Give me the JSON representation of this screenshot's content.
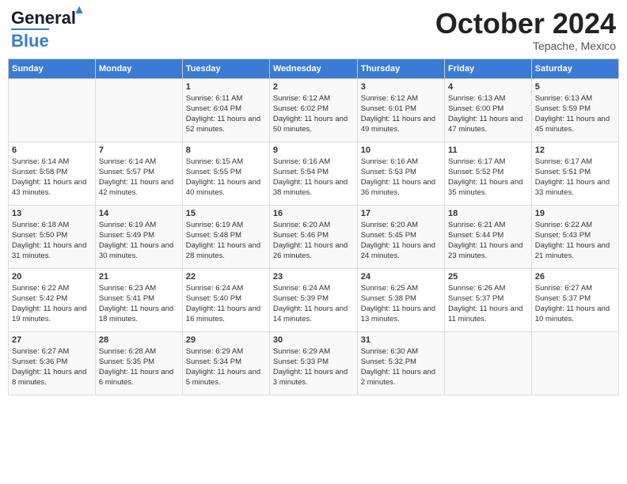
{
  "header": {
    "logo_line1": "General",
    "logo_line2": "Blue",
    "month": "October 2024",
    "location": "Tepache, Mexico"
  },
  "columns": [
    "Sunday",
    "Monday",
    "Tuesday",
    "Wednesday",
    "Thursday",
    "Friday",
    "Saturday"
  ],
  "weeks": [
    [
      {
        "day": "",
        "sunrise": "",
        "sunset": "",
        "daylight": ""
      },
      {
        "day": "",
        "sunrise": "",
        "sunset": "",
        "daylight": ""
      },
      {
        "day": "1",
        "sunrise": "Sunrise: 6:11 AM",
        "sunset": "Sunset: 6:04 PM",
        "daylight": "Daylight: 11 hours and 52 minutes."
      },
      {
        "day": "2",
        "sunrise": "Sunrise: 6:12 AM",
        "sunset": "Sunset: 6:02 PM",
        "daylight": "Daylight: 11 hours and 50 minutes."
      },
      {
        "day": "3",
        "sunrise": "Sunrise: 6:12 AM",
        "sunset": "Sunset: 6:01 PM",
        "daylight": "Daylight: 11 hours and 49 minutes."
      },
      {
        "day": "4",
        "sunrise": "Sunrise: 6:13 AM",
        "sunset": "Sunset: 6:00 PM",
        "daylight": "Daylight: 11 hours and 47 minutes."
      },
      {
        "day": "5",
        "sunrise": "Sunrise: 6:13 AM",
        "sunset": "Sunset: 5:59 PM",
        "daylight": "Daylight: 11 hours and 45 minutes."
      }
    ],
    [
      {
        "day": "6",
        "sunrise": "Sunrise: 6:14 AM",
        "sunset": "Sunset: 5:58 PM",
        "daylight": "Daylight: 11 hours and 43 minutes."
      },
      {
        "day": "7",
        "sunrise": "Sunrise: 6:14 AM",
        "sunset": "Sunset: 5:57 PM",
        "daylight": "Daylight: 11 hours and 42 minutes."
      },
      {
        "day": "8",
        "sunrise": "Sunrise: 6:15 AM",
        "sunset": "Sunset: 5:55 PM",
        "daylight": "Daylight: 11 hours and 40 minutes."
      },
      {
        "day": "9",
        "sunrise": "Sunrise: 6:16 AM",
        "sunset": "Sunset: 5:54 PM",
        "daylight": "Daylight: 11 hours and 38 minutes."
      },
      {
        "day": "10",
        "sunrise": "Sunrise: 6:16 AM",
        "sunset": "Sunset: 5:53 PM",
        "daylight": "Daylight: 11 hours and 36 minutes."
      },
      {
        "day": "11",
        "sunrise": "Sunrise: 6:17 AM",
        "sunset": "Sunset: 5:52 PM",
        "daylight": "Daylight: 11 hours and 35 minutes."
      },
      {
        "day": "12",
        "sunrise": "Sunrise: 6:17 AM",
        "sunset": "Sunset: 5:51 PM",
        "daylight": "Daylight: 11 hours and 33 minutes."
      }
    ],
    [
      {
        "day": "13",
        "sunrise": "Sunrise: 6:18 AM",
        "sunset": "Sunset: 5:50 PM",
        "daylight": "Daylight: 11 hours and 31 minutes."
      },
      {
        "day": "14",
        "sunrise": "Sunrise: 6:19 AM",
        "sunset": "Sunset: 5:49 PM",
        "daylight": "Daylight: 11 hours and 30 minutes."
      },
      {
        "day": "15",
        "sunrise": "Sunrise: 6:19 AM",
        "sunset": "Sunset: 5:48 PM",
        "daylight": "Daylight: 11 hours and 28 minutes."
      },
      {
        "day": "16",
        "sunrise": "Sunrise: 6:20 AM",
        "sunset": "Sunset: 5:46 PM",
        "daylight": "Daylight: 11 hours and 26 minutes."
      },
      {
        "day": "17",
        "sunrise": "Sunrise: 6:20 AM",
        "sunset": "Sunset: 5:45 PM",
        "daylight": "Daylight: 11 hours and 24 minutes."
      },
      {
        "day": "18",
        "sunrise": "Sunrise: 6:21 AM",
        "sunset": "Sunset: 5:44 PM",
        "daylight": "Daylight: 11 hours and 23 minutes."
      },
      {
        "day": "19",
        "sunrise": "Sunrise: 6:22 AM",
        "sunset": "Sunset: 5:43 PM",
        "daylight": "Daylight: 11 hours and 21 minutes."
      }
    ],
    [
      {
        "day": "20",
        "sunrise": "Sunrise: 6:22 AM",
        "sunset": "Sunset: 5:42 PM",
        "daylight": "Daylight: 11 hours and 19 minutes."
      },
      {
        "day": "21",
        "sunrise": "Sunrise: 6:23 AM",
        "sunset": "Sunset: 5:41 PM",
        "daylight": "Daylight: 11 hours and 18 minutes."
      },
      {
        "day": "22",
        "sunrise": "Sunrise: 6:24 AM",
        "sunset": "Sunset: 5:40 PM",
        "daylight": "Daylight: 11 hours and 16 minutes."
      },
      {
        "day": "23",
        "sunrise": "Sunrise: 6:24 AM",
        "sunset": "Sunset: 5:39 PM",
        "daylight": "Daylight: 11 hours and 14 minutes."
      },
      {
        "day": "24",
        "sunrise": "Sunrise: 6:25 AM",
        "sunset": "Sunset: 5:38 PM",
        "daylight": "Daylight: 11 hours and 13 minutes."
      },
      {
        "day": "25",
        "sunrise": "Sunrise: 6:26 AM",
        "sunset": "Sunset: 5:37 PM",
        "daylight": "Daylight: 11 hours and 11 minutes."
      },
      {
        "day": "26",
        "sunrise": "Sunrise: 6:27 AM",
        "sunset": "Sunset: 5:37 PM",
        "daylight": "Daylight: 11 hours and 10 minutes."
      }
    ],
    [
      {
        "day": "27",
        "sunrise": "Sunrise: 6:27 AM",
        "sunset": "Sunset: 5:36 PM",
        "daylight": "Daylight: 11 hours and 8 minutes."
      },
      {
        "day": "28",
        "sunrise": "Sunrise: 6:28 AM",
        "sunset": "Sunset: 5:35 PM",
        "daylight": "Daylight: 11 hours and 6 minutes."
      },
      {
        "day": "29",
        "sunrise": "Sunrise: 6:29 AM",
        "sunset": "Sunset: 5:34 PM",
        "daylight": "Daylight: 11 hours and 5 minutes."
      },
      {
        "day": "30",
        "sunrise": "Sunrise: 6:29 AM",
        "sunset": "Sunset: 5:33 PM",
        "daylight": "Daylight: 11 hours and 3 minutes."
      },
      {
        "day": "31",
        "sunrise": "Sunrise: 6:30 AM",
        "sunset": "Sunset: 5:32 PM",
        "daylight": "Daylight: 11 hours and 2 minutes."
      },
      {
        "day": "",
        "sunrise": "",
        "sunset": "",
        "daylight": ""
      },
      {
        "day": "",
        "sunrise": "",
        "sunset": "",
        "daylight": ""
      }
    ]
  ]
}
